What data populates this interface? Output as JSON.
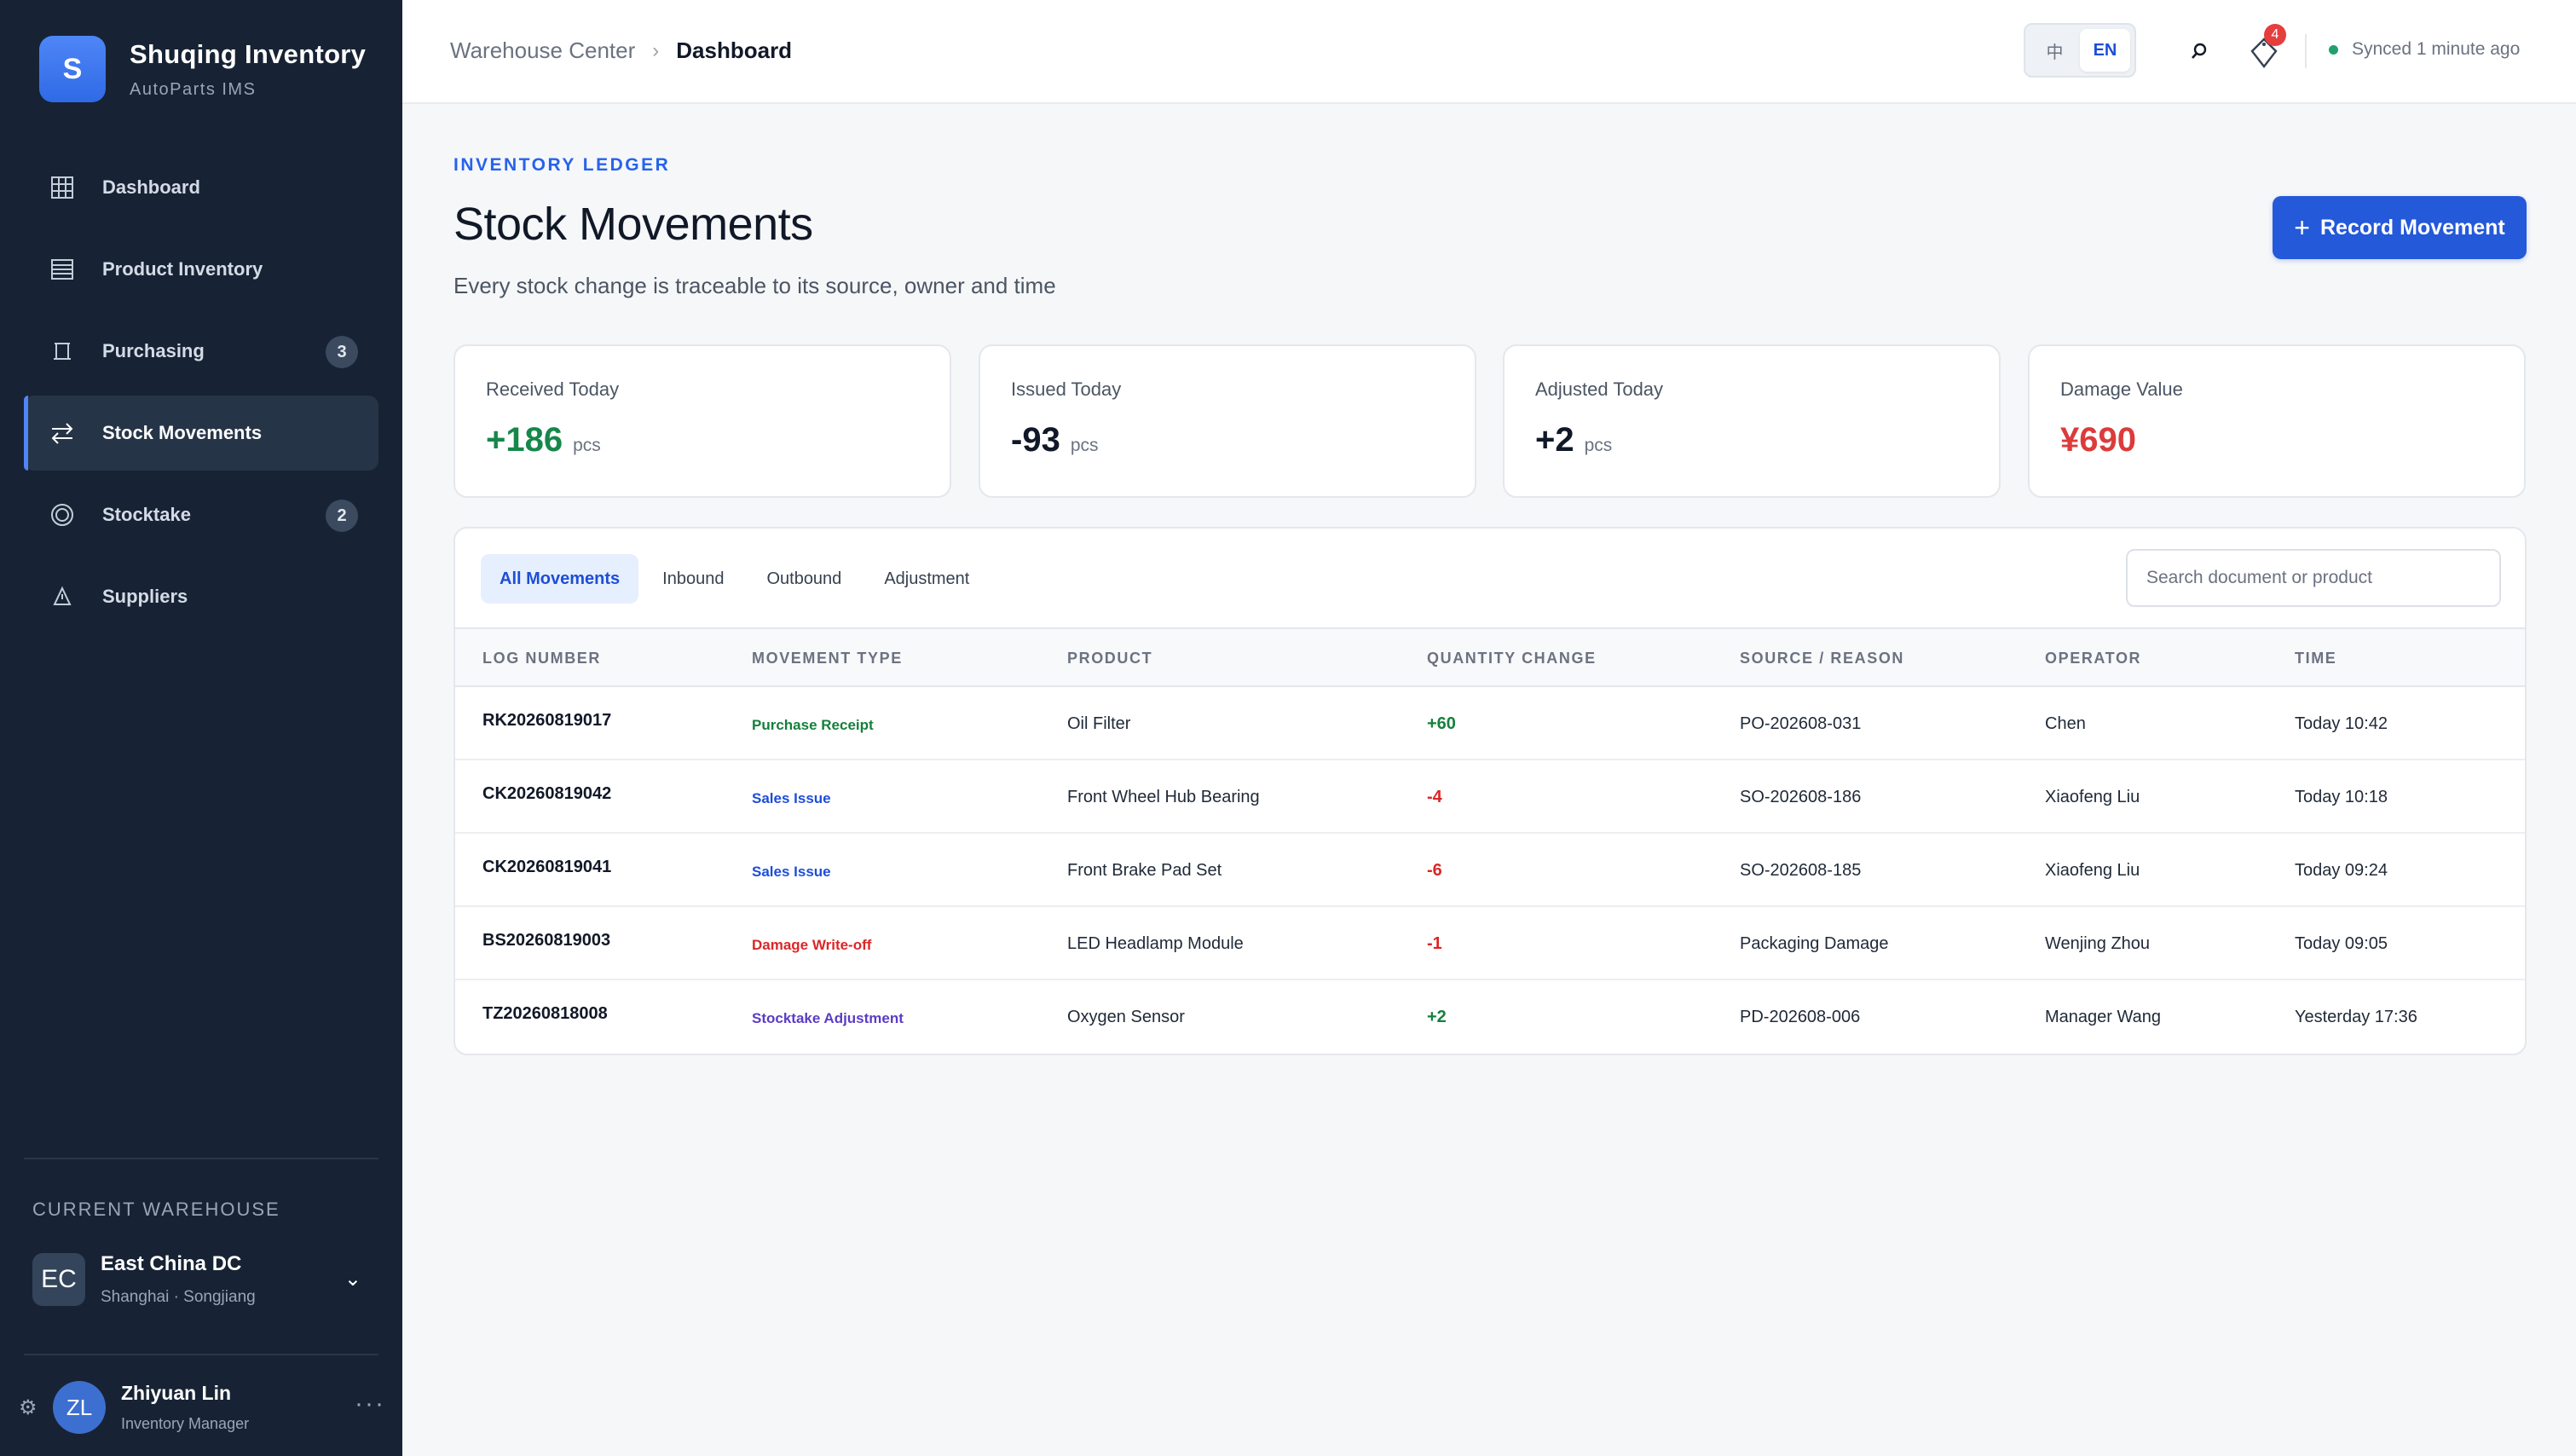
{
  "brand": {
    "logo_letter": "S",
    "name": "Shuqing Inventory",
    "subtitle": "AutoParts IMS"
  },
  "sidebar": {
    "items": [
      {
        "label": "Dashboard",
        "icon": "grid-icon",
        "badge": null,
        "active": false
      },
      {
        "label": "Product Inventory",
        "icon": "list-icon",
        "badge": null,
        "active": false
      },
      {
        "label": "Purchasing",
        "icon": "cart-icon",
        "badge": "3",
        "active": false
      },
      {
        "label": "Stock Movements",
        "icon": "arrows-icon",
        "badge": null,
        "active": true
      },
      {
        "label": "Stocktake",
        "icon": "target-icon",
        "badge": "2",
        "active": false
      },
      {
        "label": "Suppliers",
        "icon": "truck-icon",
        "badge": null,
        "active": false
      }
    ],
    "warehouse_label": "CURRENT WAREHOUSE",
    "warehouse": {
      "initials": "EC",
      "name": "East China DC",
      "location": "Shanghai · Songjiang"
    },
    "user": {
      "initials": "ZL",
      "name": "Zhiyuan Lin",
      "role": "Inventory Manager"
    }
  },
  "topbar": {
    "breadcrumb_home": "Warehouse Center",
    "breadcrumb_current": "Dashboard",
    "lang_zh": "中",
    "lang_en": "EN",
    "notification_count": "4",
    "sync_status": "Synced 1 minute ago"
  },
  "page": {
    "kicker": "INVENTORY LEDGER",
    "title": "Stock Movements",
    "subtitle": "Every stock change is traceable to its source, owner and time",
    "primary_action": "Record Movement"
  },
  "stats": [
    {
      "label": "Received Today",
      "value": "+186",
      "unit": "pcs",
      "color": "#16874a"
    },
    {
      "label": "Issued Today",
      "value": "-93",
      "unit": "pcs",
      "color": "#111827"
    },
    {
      "label": "Adjusted Today",
      "value": "+2",
      "unit": "pcs",
      "color": "#111827"
    },
    {
      "label": "Damage Value",
      "value": "¥690",
      "unit": "",
      "color": "#dc3b3b"
    }
  ],
  "tabs": [
    {
      "label": "All Movements",
      "active": true
    },
    {
      "label": "Inbound",
      "active": false
    },
    {
      "label": "Outbound",
      "active": false
    },
    {
      "label": "Adjustment",
      "active": false
    }
  ],
  "search": {
    "placeholder": "Search document or product",
    "value": ""
  },
  "table": {
    "headers": [
      "LOG NUMBER",
      "MOVEMENT TYPE",
      "PRODUCT",
      "QUANTITY CHANGE",
      "SOURCE / REASON",
      "OPERATOR",
      "TIME"
    ],
    "rows": [
      {
        "log": "RK20260819017",
        "type": "Purchase Receipt",
        "type_kind": "purchase",
        "product": "Oil Filter",
        "qty": "+60",
        "source": "PO-202608-031",
        "operator": "Chen",
        "time": "Today 10:42"
      },
      {
        "log": "CK20260819042",
        "type": "Sales Issue",
        "type_kind": "sales",
        "product": "Front Wheel Hub Bearing",
        "qty": "-4",
        "source": "SO-202608-186",
        "operator": "Xiaofeng Liu",
        "time": "Today 10:18"
      },
      {
        "log": "CK20260819041",
        "type": "Sales Issue",
        "type_kind": "sales",
        "product": "Front Brake Pad Set",
        "qty": "-6",
        "source": "SO-202608-185",
        "operator": "Xiaofeng Liu",
        "time": "Today 09:24"
      },
      {
        "log": "BS20260819003",
        "type": "Damage Write-off",
        "type_kind": "damage",
        "product": "LED Headlamp Module",
        "qty": "-1",
        "source": "Packaging Damage",
        "operator": "Wenjing Zhou",
        "time": "Today 09:05"
      },
      {
        "log": "TZ20260818008",
        "type": "Stocktake Adjustment",
        "type_kind": "stocktake",
        "product": "Oxygen Sensor",
        "qty": "+2",
        "source": "PD-202608-006",
        "operator": "Manager Wang",
        "time": "Yesterday 17:36"
      }
    ]
  }
}
